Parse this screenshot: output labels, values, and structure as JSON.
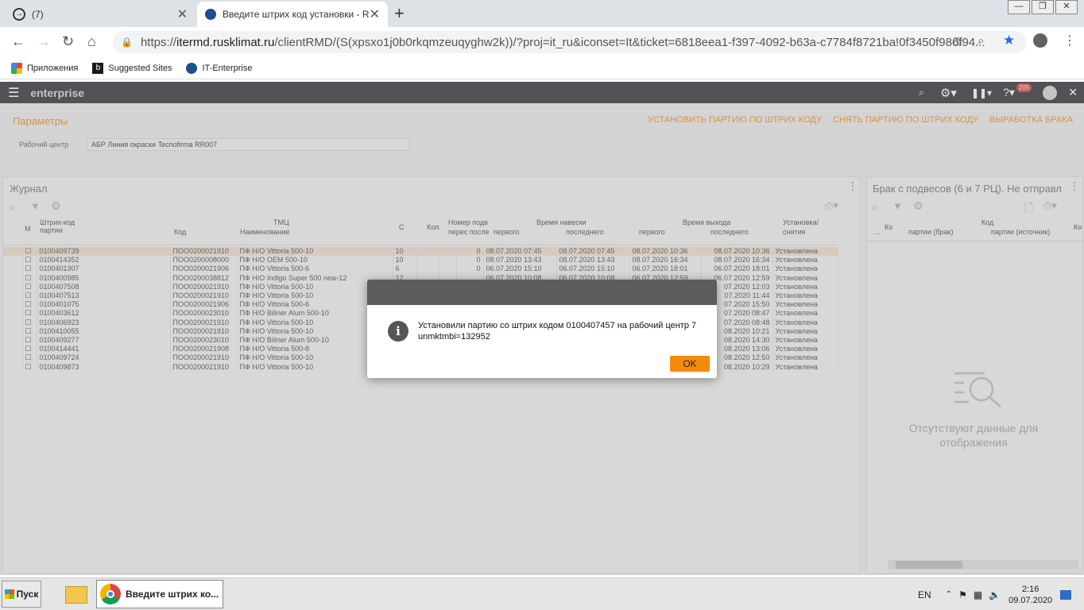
{
  "browser": {
    "tabs": [
      {
        "title": "(7)",
        "active": false
      },
      {
        "title": "Введите штрих код установки - R",
        "active": true
      }
    ],
    "url_scheme": "https://",
    "url_domain": "itermd.rusklimat.ru",
    "url_rest": "/clientRMD/(S(xpsxo1j0b0rkqmzeuqyghw2k))/?proj=it_ru&iconset=It&ticket=6818eea1-f397-4092-b63a-c7784f8721ba!0f3450f986f94...",
    "bookmarks": [
      "Приложения",
      "Suggested Sites",
      "IT-Enterprise"
    ]
  },
  "app": {
    "logo": "enterprise",
    "notif_count": "205",
    "params_title": "Параметры",
    "actions": [
      "УСТАНОВИТЬ ПАРТИЮ ПО ШТРИХ КОДУ",
      "СНЯТЬ ПАРТИЮ ПО ШТРИХ КОДУ",
      "ВЫРАБОТКА БРАКА"
    ],
    "rc_label": "Рабочий центр",
    "rc_value": "АБР Линия окраски Tecnofirma RR007",
    "journal": {
      "title": "Журнал",
      "headers": {
        "m": "М",
        "barcode": "Штрих-код",
        "party": "партии",
        "tmc": "ТМЦ",
        "code": "Код",
        "name": "Наименование",
        "c": "С",
        "qty": "Кол.",
        "hang_no": "Номер подв",
        "hang_sub": "перес после",
        "in_time": "Время навески",
        "first": "первого",
        "last": "последнего",
        "out_time": "Время выхода",
        "first2": "первого",
        "last2": "последнего",
        "status": "Установка/",
        "status2": "снятия"
      },
      "rows": [
        {
          "barcode": "0100409739",
          "code": "ПОО0200021910",
          "name": "ПФ Н/О Vittoria 500-10",
          "c": "10",
          "p": "0",
          "t1": "08.07.2020 07:45",
          "t2": "08.07.2020 07:45",
          "t3": "08.07.2020 10:36",
          "t4": "08.07.2020 10:36",
          "st": "Установлена"
        },
        {
          "barcode": "0100414352",
          "code": "ПОО0200008000",
          "name": "ПФ Н/О OEM 500-10",
          "c": "10",
          "p": "0",
          "t1": "08.07.2020 13:43",
          "t2": "08.07.2020 13:43",
          "t3": "08.07.2020 16:34",
          "t4": "08.07.2020 16:34",
          "st": "Установлена"
        },
        {
          "barcode": "0100401307",
          "code": "ПОО0200021906",
          "name": "ПФ Н/О Vittoria 500-6",
          "c": "6",
          "p": "0",
          "t1": "06.07.2020 15:10",
          "t2": "06.07.2020 15:10",
          "t3": "06.07.2020 18:01",
          "t4": "06.07.2020 18:01",
          "st": "Установлена"
        },
        {
          "barcode": "0100400985",
          "code": "ПОО0200038812",
          "name": "ПФ Н/О Indigo Super 500 new-12",
          "c": "12",
          "p": "",
          "t1": "06.07.2020 10:08",
          "t2": "06.07.2020 10:08",
          "t3": "06.07.2020 12:59",
          "t4": "06.07.2020 12:59",
          "st": "Установлена"
        },
        {
          "barcode": "0100407508",
          "code": "ПОО0200021910",
          "name": "ПФ Н/О Vittoria 500-10",
          "c": "",
          "p": "",
          "t1": "",
          "t2": "",
          "t3": "",
          "t4": "07.2020 12:03",
          "st": "Установлена"
        },
        {
          "barcode": "0100407513",
          "code": "ПОО0200021910",
          "name": "ПФ Н/О Vittoria 500-10",
          "c": "",
          "p": "",
          "t1": "",
          "t2": "",
          "t3": "",
          "t4": "07.2020 11:44",
          "st": "Установлена"
        },
        {
          "barcode": "0100401075",
          "code": "ПОО0200021906",
          "name": "ПФ Н/О Vittoria 500-6",
          "c": "",
          "p": "",
          "t1": "",
          "t2": "",
          "t3": "",
          "t4": "07.2020 15:50",
          "st": "Установлена"
        },
        {
          "barcode": "0100403612",
          "code": "ПОО0200023010",
          "name": "ПФ Н/О Biliner Alum 500-10",
          "c": "",
          "p": "",
          "t1": "",
          "t2": "",
          "t3": "",
          "t4": "07.2020 08:47",
          "st": "Установлена"
        },
        {
          "barcode": "0100406923",
          "code": "ПОО0200021910",
          "name": "ПФ Н/О Vittoria 500-10",
          "c": "",
          "p": "",
          "t1": "",
          "t2": "",
          "t3": "",
          "t4": "07.2020 08:48",
          "st": "Установлена"
        },
        {
          "barcode": "0100410055",
          "code": "ПОО0200021910",
          "name": "ПФ Н/О Vittoria 500-10",
          "c": "",
          "p": "",
          "t1": "",
          "t2": "",
          "t3": "",
          "t4": "08.2020 10:21",
          "st": "Установлена"
        },
        {
          "barcode": "0100409277",
          "code": "ПОО0200023010",
          "name": "ПФ Н/О Biliner Alum 500-10",
          "c": "",
          "p": "",
          "t1": "",
          "t2": "",
          "t3": "",
          "t4": "08.2020 14:30",
          "st": "Установлена"
        },
        {
          "barcode": "0100414441",
          "code": "ПОО0200021908",
          "name": "ПФ Н/О Vittoria 500-8",
          "c": "",
          "p": "",
          "t1": "",
          "t2": "",
          "t3": "",
          "t4": "08.2020 13:06",
          "st": "Установлена"
        },
        {
          "barcode": "0100409724",
          "code": "ПОО0200021910",
          "name": "ПФ Н/О Vittoria 500-10",
          "c": "",
          "p": "",
          "t1": "",
          "t2": "",
          "t3": "",
          "t4": "08.2020 12:50",
          "st": "Установлена"
        },
        {
          "barcode": "0100409873",
          "code": "ПОО0200021910",
          "name": "ПФ Н/О Vittoria 500-10",
          "c": "",
          "p": "",
          "t1": "",
          "t2": "",
          "t3": "",
          "t4": "08.2020 10:29",
          "st": "Установлена"
        }
      ]
    },
    "brak": {
      "title": "Брак с подвесов (6 и 7 РЦ). Не отправл",
      "col_ko": "Ко",
      "col_kod": "Код",
      "col_party": "партии (брак)",
      "col_source": "партии (источник)",
      "col_ko2": "Ко",
      "empty": "Отсутствуют данные для отображения"
    }
  },
  "dialog": {
    "icon": "i",
    "line1": "Установили партию со штрих кодом 0100407457 на рабочий центр 7",
    "line2": "unmktmbi=132952",
    "ok": "OK"
  },
  "taskbar": {
    "start": "Пуск",
    "chrome_task": "Введите штрих ко...",
    "lang": "EN",
    "time": "2:16",
    "date": "09.07.2020"
  }
}
